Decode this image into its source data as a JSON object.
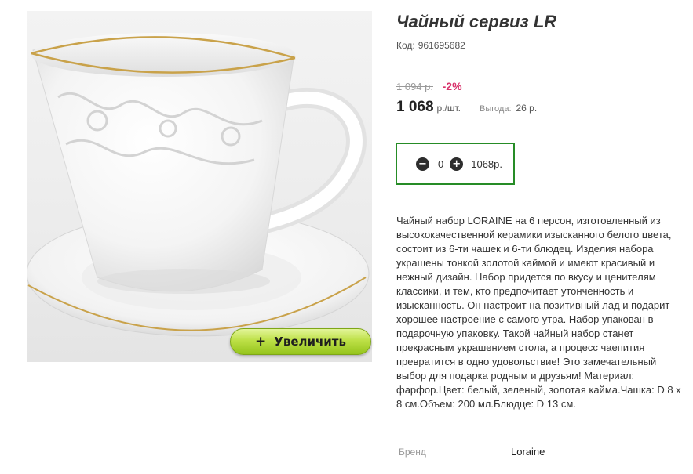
{
  "product": {
    "title": "Чайный сервиз LR",
    "code_label": "Код:",
    "code_value": "961695682"
  },
  "image": {
    "zoom_label": "Увеличить",
    "zoom_icon": "+"
  },
  "pricing": {
    "old_price": "1 094 р.",
    "discount": "-2%",
    "price": "1 068",
    "price_unit": "р./шт.",
    "benefit_label": "Выгода:",
    "benefit_value": "26 р."
  },
  "cart": {
    "minus_icon": "−",
    "plus_icon": "+",
    "quantity": "0",
    "total": "1068р.",
    "border_color": "#268c26"
  },
  "description": "Чайный набор LORAINE на 6 персон, изготовленный из высококачественной керамики изысканного белого цвета, состоит из 6-ти чашек и 6-ти блюдец. Изделия набора украшены тонкой золотой каймой и имеют красивый и нежный дизайн. Набор придется по вкусу и ценителям классики, и тем, кто предпочитает утонченность и изысканность. Он настроит на позитивный лад и подарит хорошее настроение с самого утра. Набор упакован в подарочную упаковку. Такой чайный набор станет прекрасным украшением стола, а процесс чаепития превратится в одно удовольствие! Это замечательный выбор для подарка родным и друзьям! Материал: фарфор.Цвет: белый, зеленый, золотая кайма.Чашка: D 8 х 8 см.Объем: 200 мл.Блюдце: D 13 см.",
  "attributes": {
    "brand_label": "Бренд",
    "brand_value": "Loraine"
  },
  "colors": {
    "discount": "#d8336b",
    "zoom_button": "#b5db3f",
    "gold_rim": "#c9a24a"
  }
}
